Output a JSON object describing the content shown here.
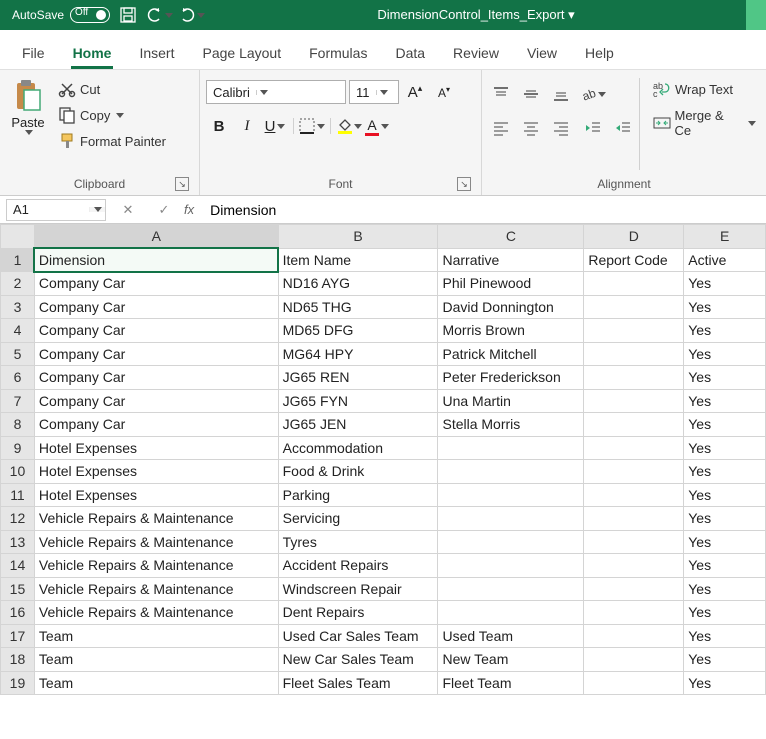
{
  "titlebar": {
    "autosave_label": "AutoSave",
    "autosave_state": "Off",
    "document_name": "DimensionControl_Items_Export ▾"
  },
  "tabs": [
    "File",
    "Home",
    "Insert",
    "Page Layout",
    "Formulas",
    "Data",
    "Review",
    "View",
    "Help"
  ],
  "active_tab": 1,
  "ribbon": {
    "clipboard": {
      "paste": "Paste",
      "cut": "Cut",
      "copy": "Copy",
      "format_painter": "Format Painter",
      "group_label": "Clipboard"
    },
    "font": {
      "font_name": "Calibri",
      "font_size": "11",
      "group_label": "Font"
    },
    "alignment": {
      "wrap_text": "Wrap Text",
      "merge_center": "Merge & Ce",
      "group_label": "Alignment"
    }
  },
  "formula_bar": {
    "cell_ref": "A1",
    "formula": "Dimension"
  },
  "columns": [
    "A",
    "B",
    "C",
    "D",
    "E"
  ],
  "headers": [
    "Dimension",
    "Item Name",
    "Narrative",
    "Report Code",
    "Active"
  ],
  "rows": [
    [
      "Company Car",
      "ND16 AYG",
      "Phil Pinewood",
      "",
      "Yes"
    ],
    [
      "Company Car",
      "ND65 THG",
      "David Donnington",
      "",
      "Yes"
    ],
    [
      "Company Car",
      "MD65 DFG",
      "Morris Brown",
      "",
      "Yes"
    ],
    [
      "Company Car",
      "MG64 HPY",
      "Patrick Mitchell",
      "",
      "Yes"
    ],
    [
      "Company Car",
      "JG65 REN",
      "Peter Frederickson",
      "",
      "Yes"
    ],
    [
      "Company Car",
      "JG65 FYN",
      "Una Martin",
      "",
      "Yes"
    ],
    [
      "Company Car",
      "JG65 JEN",
      "Stella Morris",
      "",
      "Yes"
    ],
    [
      "Hotel Expenses",
      "Accommodation",
      "",
      "",
      "Yes"
    ],
    [
      "Hotel Expenses",
      "Food & Drink",
      "",
      "",
      "Yes"
    ],
    [
      "Hotel Expenses",
      "Parking",
      "",
      "",
      "Yes"
    ],
    [
      "Vehicle Repairs & Maintenance",
      "Servicing",
      "",
      "",
      "Yes"
    ],
    [
      "Vehicle Repairs & Maintenance",
      "Tyres",
      "",
      "",
      "Yes"
    ],
    [
      "Vehicle Repairs & Maintenance",
      "Accident Repairs",
      "",
      "",
      "Yes"
    ],
    [
      "Vehicle Repairs & Maintenance",
      "Windscreen Repair",
      "",
      "",
      "Yes"
    ],
    [
      "Vehicle Repairs & Maintenance",
      "Dent Repairs",
      "",
      "",
      "Yes"
    ],
    [
      "Team",
      "Used Car Sales Team",
      "Used Team",
      "",
      "Yes"
    ],
    [
      "Team",
      "New Car Sales Team",
      "New Team",
      "",
      "Yes"
    ],
    [
      "Team",
      "Fleet Sales Team",
      "Fleet Team",
      "",
      "Yes"
    ]
  ],
  "selected_cell": {
    "row": 0,
    "col": 0
  }
}
